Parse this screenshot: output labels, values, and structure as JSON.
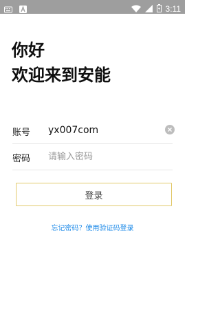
{
  "status_bar": {
    "time": "3:11",
    "icons": [
      "keyboard-icon",
      "a-app-icon",
      "wifi-icon",
      "signal-icon",
      "battery-icon"
    ]
  },
  "greeting": {
    "line1": "你好",
    "line2": "欢迎来到安能"
  },
  "form": {
    "account_label": "账号",
    "account_value": "yx007com",
    "password_label": "密码",
    "password_placeholder": "请输入密码"
  },
  "login_button_label": "登录",
  "forgot_link": "忘记密码？使用验证码登录",
  "colors": {
    "button_border": "#e2c96a",
    "link": "#1f8be8",
    "status_bar": "#9e9e9e"
  }
}
